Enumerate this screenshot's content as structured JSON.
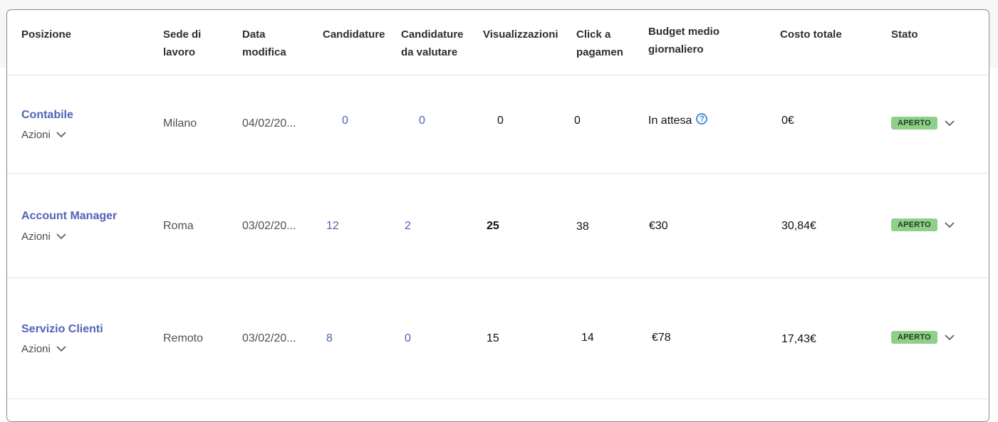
{
  "columns": {
    "posizione": "Posizione",
    "sede": "Sede di\nlavoro",
    "data": "Data\nmodifica",
    "candidature": "Candidature",
    "da_valutare": "Candidature\nda valutare",
    "visualizzazioni": "Visualizzazioni",
    "click": "Click a\npagamen",
    "budget": "Budget medio\ngiornaliero",
    "costo": "Costo totale",
    "stato": "Stato"
  },
  "rows": [
    {
      "title": "Contabile",
      "actions": "Azioni",
      "location": "Milano",
      "modified": "04/02/20...",
      "applications": "0",
      "to_review": "0",
      "views": "0",
      "paid_clicks": "0",
      "budget": "In attesa",
      "budget_help_icon": "question-circle-icon",
      "total_cost": "0€",
      "status": "APERTO"
    },
    {
      "title": "Account Manager",
      "actions": "Azioni",
      "location": "Roma",
      "modified": "03/02/20...",
      "applications": "12",
      "to_review": "2",
      "views": "25",
      "paid_clicks": "38",
      "budget": "€30",
      "total_cost": "30,84€",
      "status": "APERTO"
    },
    {
      "title": "Servizio Clienti",
      "actions": "Azioni",
      "location": "Remoto",
      "modified": "03/02/20...",
      "applications": "8",
      "to_review": "0",
      "views": "15",
      "paid_clicks": "14",
      "budget": "€78",
      "total_cost": "17,43€",
      "status": "APERTO"
    }
  ],
  "colors": {
    "link": "#5063b9",
    "badge": "#8fcf89",
    "help_icon": "#4a90d9"
  }
}
